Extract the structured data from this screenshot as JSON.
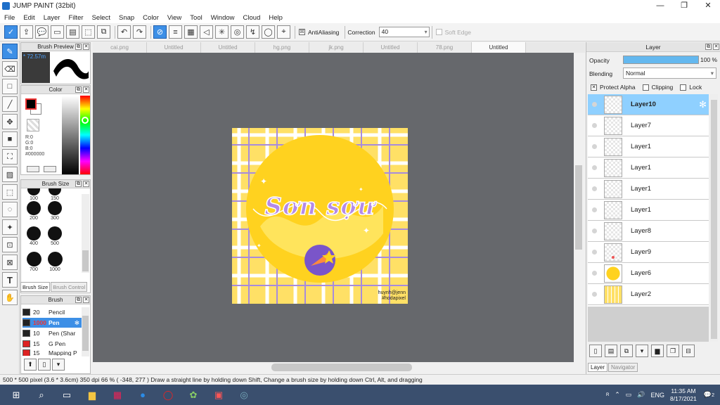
{
  "window": {
    "title": "JUMP PAINT (32bit)",
    "minimize": "—",
    "maximize": "❐",
    "close": "✕"
  },
  "menu": [
    "File",
    "Edit",
    "Layer",
    "Filter",
    "Select",
    "Snap",
    "Color",
    "View",
    "Tool",
    "Window",
    "Cloud",
    "Help"
  ],
  "toolbar": {
    "antialiasing_label": "AntiAliasing",
    "antialiasing_checked": "☒",
    "correction_label": "Correction",
    "correction_value": "40",
    "softedge_label": "Soft Edge",
    "icons": [
      "select-all-icon",
      "export-icon",
      "speech-icon",
      "monitor-icon",
      "page-icon",
      "deselect-icon",
      "cloud-sync-icon",
      "undo-icon",
      "redo-icon",
      "snap-off-icon",
      "parallel-snap-icon",
      "grid-snap-icon",
      "perspective-snap-icon",
      "radial-snap-icon",
      "concentric-snap-icon",
      "curve-snap-icon",
      "settings-snap-icon",
      "pin-icon"
    ]
  },
  "brush_preview": {
    "header": "Brush Preview",
    "size_label": "* 72.57m"
  },
  "color_panel": {
    "header": "Color",
    "r": "R:0",
    "g": "G:0",
    "b": "B:0",
    "hex": "#000000",
    "fg_color": "#000000",
    "bg_color": "#ffffff"
  },
  "brush_size_panel": {
    "header": "Brush Size",
    "sizes": [
      "100",
      "150",
      "200",
      "300",
      "400",
      "500",
      "700",
      "1000"
    ],
    "tab_active": "Brush Size",
    "tab_inactive": "Brush Control"
  },
  "brush_panel": {
    "header": "Brush",
    "items": [
      {
        "size": "20",
        "name": "Pencil",
        "color": "#222222"
      },
      {
        "size": "1000",
        "name": "Pen",
        "color": "#222222"
      },
      {
        "size": "10",
        "name": "Pen (Shar",
        "color": "#222222"
      },
      {
        "size": "15",
        "name": "G Pen",
        "color": "#dd2222"
      },
      {
        "size": "15",
        "name": "Mapping P",
        "color": "#dd2222"
      }
    ]
  },
  "doc_tabs": [
    "cai.png",
    "Untitled",
    "Untitled",
    "hg.png",
    "jk.png",
    "Untitled",
    "78.png",
    "Untitled"
  ],
  "artwork": {
    "title": "Sơn sợư",
    "signature_line1": "huynh@jenn",
    "signature_line2": "#hodapixel"
  },
  "layer_panel": {
    "header": "Layer",
    "opacity_label": "Opacity",
    "opacity_value": "100 %",
    "opacity_fraction": 1.0,
    "blending_label": "Blending",
    "blending_value": "Normal",
    "protect_alpha": "Protect Alpha",
    "clipping": "Clipping",
    "lock": "Lock",
    "layers": [
      "Layer10",
      "Layer7",
      "Layer1",
      "Layer1",
      "Layer1",
      "Layer1",
      "Layer8",
      "Layer9",
      "Layer6",
      "Layer2"
    ],
    "tab_active": "Layer",
    "tab_inactive": "Navigator"
  },
  "status": {
    "text": "500 * 500 pixel   (3.6 * 3.6cm)   350 dpi   66 %   ( -348, 277 )   Draw a straight line by holding down Shift, Change a brush size by holding down Ctrl, Alt, and dragging"
  },
  "taskbar": {
    "time": "11:35 AM",
    "date": "8/17/2021",
    "lang": "ENG",
    "notif_count": "2"
  },
  "colors": {
    "accent": "#3d8fe6",
    "selected_layer": "#8fd0ff",
    "canvas_bg": "#66686c",
    "art_yellow": "#ffe066",
    "art_purple": "#b48ae8"
  }
}
